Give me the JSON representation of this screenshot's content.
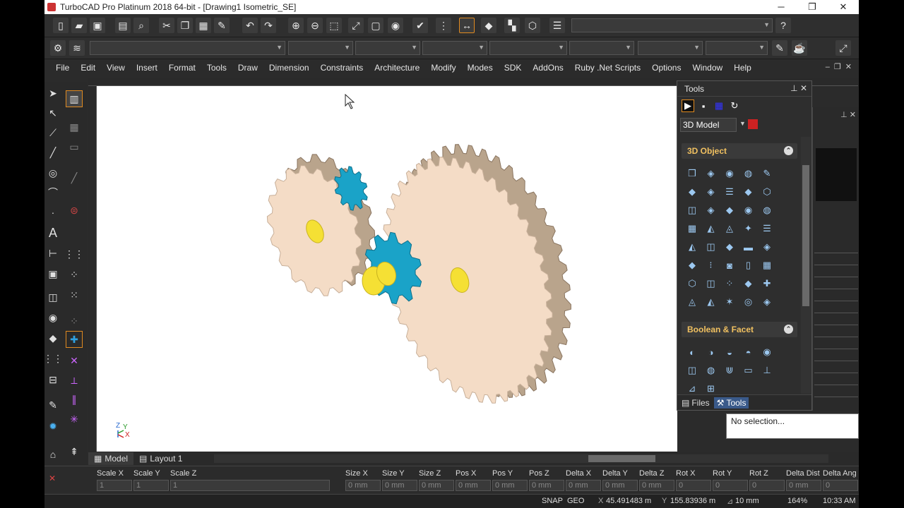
{
  "window": {
    "title": "TurboCAD Pro Platinum 2018 64-bit - [Drawing1 Isometric_SE]",
    "minimize": "─",
    "maximize": "❐",
    "close": "✕"
  },
  "menu": [
    "File",
    "Edit",
    "View",
    "Insert",
    "Format",
    "Tools",
    "Draw",
    "Dimension",
    "Constraints",
    "Architecture",
    "Modify",
    "Modes",
    "SDK",
    "AddOns",
    "Ruby .Net Scripts",
    "Options",
    "Window",
    "Help"
  ],
  "tabs": {
    "model": "Model",
    "layout": "Layout 1"
  },
  "tools_panel": {
    "title": "Tools",
    "dropdown_value": "3D Model",
    "sections": [
      {
        "label": "3D Object"
      },
      {
        "label": "Boolean & Facet"
      }
    ],
    "tabs": {
      "files": "Files",
      "tools": "Tools"
    }
  },
  "selection_info": "No selection...",
  "inspector": {
    "fields": [
      {
        "label": "Scale X",
        "value": "1"
      },
      {
        "label": "Scale Y",
        "value": "1"
      },
      {
        "label": "Scale Z",
        "value": "1"
      },
      {
        "label": "Size X",
        "value": "0 mm"
      },
      {
        "label": "Size Y",
        "value": "0 mm"
      },
      {
        "label": "Size Z",
        "value": "0 mm"
      },
      {
        "label": "Pos X",
        "value": "0 mm"
      },
      {
        "label": "Pos Y",
        "value": "0 mm"
      },
      {
        "label": "Pos Z",
        "value": "0 mm"
      },
      {
        "label": "Delta X",
        "value": "0 mm"
      },
      {
        "label": "Delta Y",
        "value": "0 mm"
      },
      {
        "label": "Delta Z",
        "value": "0 mm"
      },
      {
        "label": "Rot X",
        "value": "0"
      },
      {
        "label": "Rot Y",
        "value": "0"
      },
      {
        "label": "Rot Z",
        "value": "0"
      },
      {
        "label": "Delta Dist",
        "value": "0 mm"
      },
      {
        "label": "Delta Ang",
        "value": "0"
      }
    ]
  },
  "status": {
    "snap": "SNAP",
    "geo": "GEO",
    "x": "45.491483 m",
    "y": "155.83936 m",
    "step": "10 mm",
    "zoom": "164%",
    "time": "10:33 AM"
  },
  "axis_labels": {
    "z": "Z",
    "y": "Y",
    "x": "X"
  },
  "colors": {
    "gear_face": "#f4dcc6",
    "gear_side": "#b9a48c",
    "gear_blue": "#1aa3c8",
    "gear_hole": "#f5e034"
  }
}
